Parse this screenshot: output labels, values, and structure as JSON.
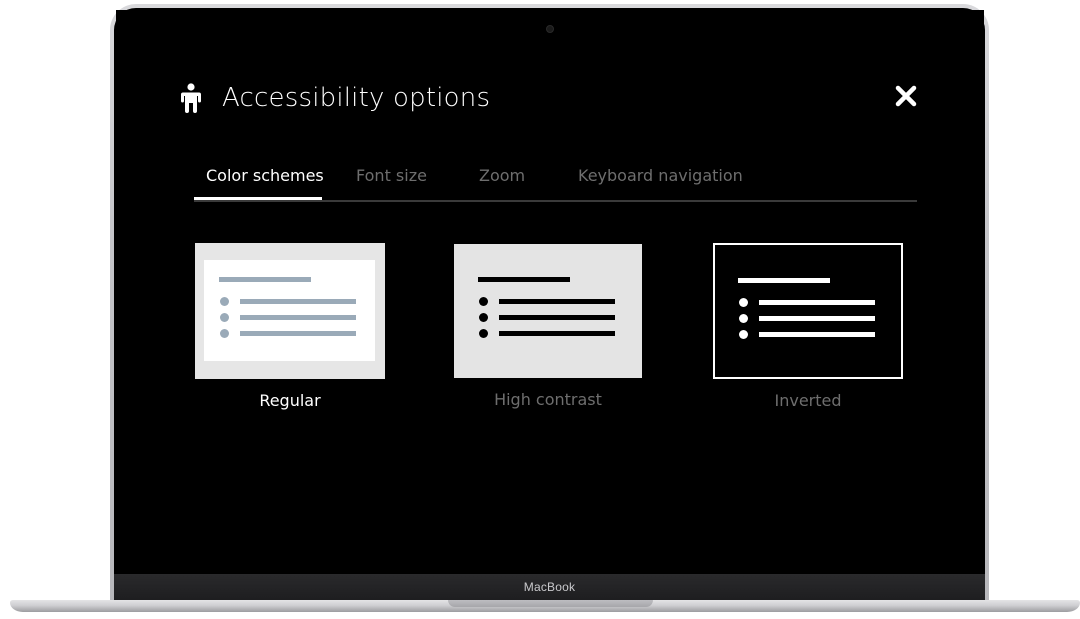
{
  "dialog": {
    "title": "Accessibility options",
    "icon": "person-icon",
    "close_icon": "close-icon"
  },
  "tabs": [
    {
      "label": "Color schemes",
      "active": true
    },
    {
      "label": "Font size",
      "active": false
    },
    {
      "label": "Zoom",
      "active": false
    },
    {
      "label": "Keyboard navigation",
      "active": false
    }
  ],
  "schemes": [
    {
      "label": "Regular",
      "selected": true
    },
    {
      "label": "High contrast",
      "selected": false
    },
    {
      "label": "Inverted",
      "selected": false
    }
  ],
  "device": {
    "label": "MacBook"
  },
  "colors": {
    "screen_bg": "#000000",
    "active_text": "#ffffff",
    "inactive_text": "#6e6e6e",
    "regular_lines": "#9aaab8"
  }
}
